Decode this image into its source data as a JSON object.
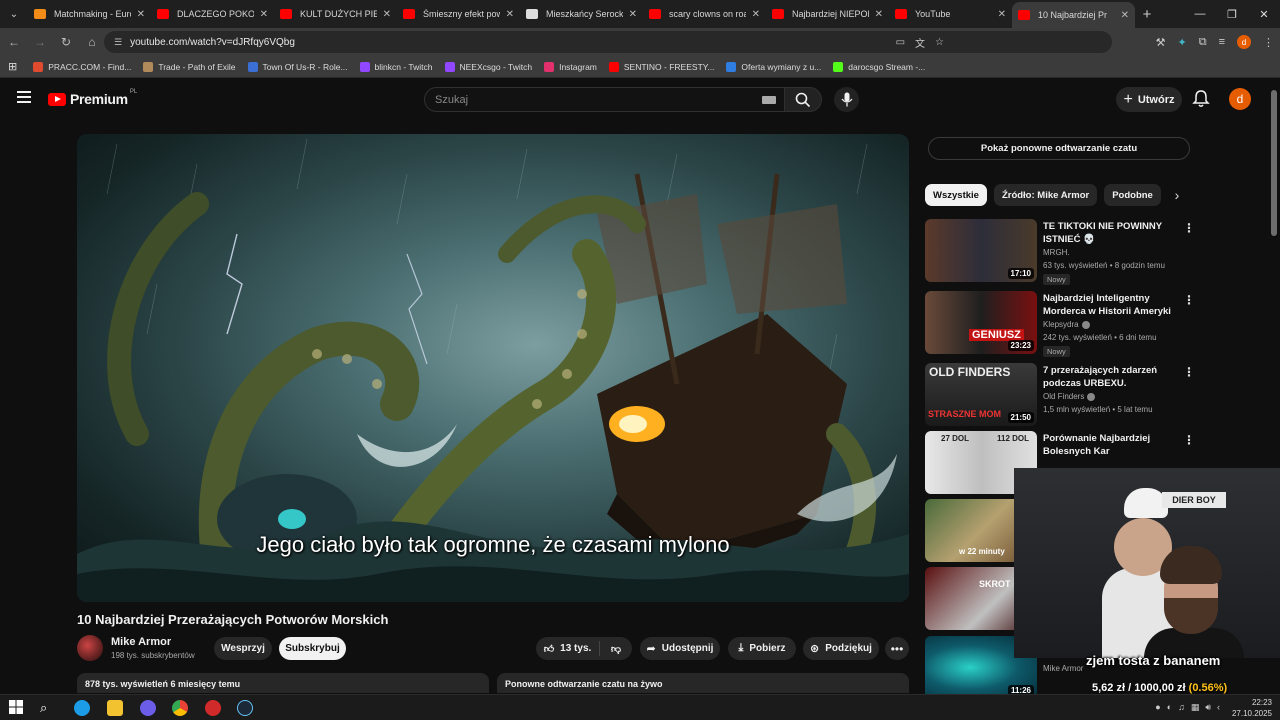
{
  "browser": {
    "tabs": [
      {
        "title": "Matchmaking - Europ",
        "color": "#f28b18"
      },
      {
        "title": "DLACZEGO POKOLEN",
        "color": "#ff0000"
      },
      {
        "title": "KULT DUŻYCH PIERSI",
        "color": "#ff0000"
      },
      {
        "title": "Śmieszny efekt powi",
        "color": "#ff0000"
      },
      {
        "title": "Mieszkańcy Serocka",
        "color": "#dddddd"
      },
      {
        "title": "scary clowns on road",
        "color": "#ff0000"
      },
      {
        "title": "Najbardziej NIEPOKO",
        "color": "#ff0000"
      },
      {
        "title": "YouTube",
        "color": "#ff0000"
      },
      {
        "title": "10 Najbardziej Pr",
        "color": "#ff0000"
      }
    ],
    "url": "youtube.com/watch?v=dJRfqy6VQbg",
    "profile_initial": "d",
    "bookmarks": [
      {
        "label": "PRACC.COM - Find...",
        "color": "#e04a2f"
      },
      {
        "label": "Trade - Path of Exile",
        "color": "#b08a5a"
      },
      {
        "label": "Town Of Us-R - Role...",
        "color": "#3b6fd6"
      },
      {
        "label": "blinkcn - Twitch",
        "color": "#9146ff"
      },
      {
        "label": "NEEXcsgo - Twitch",
        "color": "#9146ff"
      },
      {
        "label": "Instagram",
        "color": "#e1306c"
      },
      {
        "label": "SENTINO - FREESTY...",
        "color": "#ff0000"
      },
      {
        "label": "Oferta wymiany z u...",
        "color": "#2f7de1"
      },
      {
        "label": "darocsgo Stream -...",
        "color": "#53fc18"
      }
    ]
  },
  "youtube": {
    "logo_text": "Premium",
    "logo_region": "PL",
    "search_placeholder": "Szukaj",
    "create_label": "Utwórz",
    "avatar_initial": "d"
  },
  "video": {
    "subtitle": "Jego ciało było tak ogromne, że czasami mylono",
    "title": "10 Najbardziej Przerażających Potworów Morskich",
    "channel": "Mike Armor",
    "subscribers": "198 tys. subskrybentów",
    "support_label": "Wesprzyj",
    "subscribe_label": "Subskrybuj",
    "likes": "13 tys.",
    "share_label": "Udostępnij",
    "download_label": "Pobierz",
    "thanks_label": "Podziękuj",
    "views_date": "878 tys. wyświetleń  6 miesięcy temu",
    "chat_replay_bar": "Ponowne odtwarzanie czatu na żywo"
  },
  "sidebar": {
    "chat_replay_button": "Pokaż ponowne odtwarzanie czatu",
    "chips": [
      "Wszystkie",
      "Źródło: Mike Armor",
      "Podobne"
    ],
    "recommendations": [
      {
        "title": "TE TIKTOKI NIE POWINNY ISTNIEĆ 💀",
        "channel": "MRGH.",
        "meta": "63 tys. wyświetleń • 8 godzin temu",
        "badge": "Nowy",
        "duration": "17:10",
        "verified": false
      },
      {
        "title": "Najbardziej Inteligentny Morderca w Historii Ameryki",
        "channel": "Klepsydra",
        "meta": "242 tys. wyświetleń • 6 dni temu",
        "badge": "Nowy",
        "duration": "23:23",
        "verified": true
      },
      {
        "title": "7 przerażających zdarzeń podczas URBEXU.",
        "channel": "Old Finders",
        "meta": "1,5 mln wyświetleń • 5 lat temu",
        "badge": "",
        "duration": "21:50",
        "verified": true
      },
      {
        "title": "Porównanie Najbardziej Bolesnych Kar",
        "channel": "",
        "meta": "",
        "badge": "",
        "duration": "",
        "verified": false
      },
      {
        "title": "",
        "channel": "",
        "meta": "",
        "badge": "",
        "duration": "",
        "verified": false
      },
      {
        "title": "",
        "channel": "",
        "meta": "",
        "badge": "",
        "duration": "",
        "verified": false
      },
      {
        "title": "",
        "channel": "Mike Armor",
        "meta": "",
        "badge": "",
        "duration": "11:26",
        "verified": false
      }
    ],
    "thumb_texts": [
      "GENIUSZ",
      "OLD FINDERS",
      "STRASZNE MOM",
      "27 DOL",
      "112 DOL",
      "SKROT",
      "w 22 minuty"
    ]
  },
  "stream_overlay": {
    "webcam_sign": "DIER BOY",
    "donation_message": "zjem tosta z bananem",
    "donation_progress_current": "5,62 zł",
    "donation_progress_goal": "1000,00 zł",
    "donation_progress_pct": "(0.56%)",
    "donation_progress_fraction": 0.0056
  },
  "taskbar": {
    "time": "22:23",
    "date": "27.10.2025"
  }
}
